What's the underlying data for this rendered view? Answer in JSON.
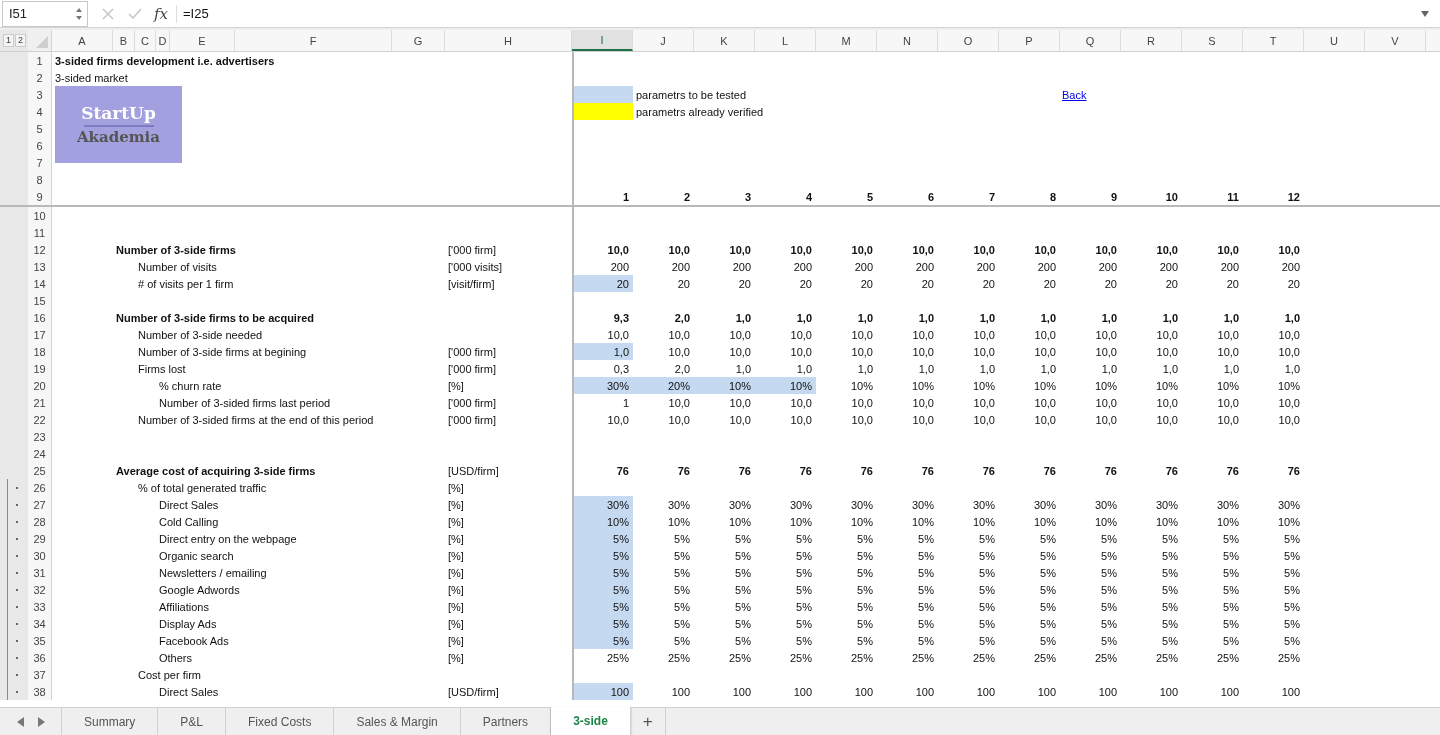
{
  "formula_bar": {
    "name_box": "I51",
    "function_label": "fx",
    "formula": "=I25"
  },
  "outline_levels": [
    "1",
    "2"
  ],
  "columns": [
    {
      "label": "A",
      "selected": false
    },
    {
      "label": "B",
      "selected": false
    },
    {
      "label": "C",
      "selected": false
    },
    {
      "label": "D",
      "selected": false
    },
    {
      "label": "E",
      "selected": false
    },
    {
      "label": "F",
      "selected": false
    },
    {
      "label": "G",
      "selected": false
    },
    {
      "label": "H",
      "selected": false
    },
    {
      "label": "I",
      "selected": true
    },
    {
      "label": "J",
      "selected": false
    },
    {
      "label": "K",
      "selected": false
    },
    {
      "label": "L",
      "selected": false
    },
    {
      "label": "M",
      "selected": false
    },
    {
      "label": "N",
      "selected": false
    },
    {
      "label": "O",
      "selected": false
    },
    {
      "label": "P",
      "selected": false
    },
    {
      "label": "Q",
      "selected": false
    },
    {
      "label": "R",
      "selected": false
    },
    {
      "label": "S",
      "selected": false
    },
    {
      "label": "T",
      "selected": false
    },
    {
      "label": "U",
      "selected": false
    },
    {
      "label": "V",
      "selected": false
    }
  ],
  "logo": {
    "title": "StartUp",
    "subtitle": "Akademia"
  },
  "frozen_rows": [
    {
      "n": "1",
      "kind": "title",
      "label": "3-sided firms development i.e. advertisers"
    },
    {
      "n": "2",
      "kind": "note",
      "label": "3-sided market"
    },
    {
      "n": "3",
      "kind": "legend",
      "legend": {
        "color": "#c5d9f1",
        "label": "parametrs to be tested"
      },
      "link": "Back"
    },
    {
      "n": "4",
      "kind": "legend",
      "legend": {
        "color": "#ffff00",
        "label": "parametrs already verified"
      }
    },
    {
      "n": "5",
      "kind": "blank"
    },
    {
      "n": "6",
      "kind": "blank"
    },
    {
      "n": "7",
      "kind": "blank"
    },
    {
      "n": "8",
      "kind": "blank"
    },
    {
      "n": "9",
      "kind": "index",
      "values": [
        "1",
        "2",
        "3",
        "4",
        "5",
        "6",
        "7",
        "8",
        "9",
        "10",
        "11",
        "12"
      ],
      "highlighted": [
        false,
        false,
        false,
        false,
        false,
        false,
        false,
        false,
        false,
        false,
        false,
        false
      ]
    }
  ],
  "rows": [
    {
      "n": "10",
      "kind": "blank",
      "grouped": false
    },
    {
      "n": "11",
      "kind": "blank",
      "grouped": false
    },
    {
      "n": "12",
      "kind": "heading",
      "grouped": false,
      "label": "Number of 3-side firms",
      "unit": "['000 firm]",
      "values": [
        "10,0",
        "10,0",
        "10,0",
        "10,0",
        "10,0",
        "10,0",
        "10,0",
        "10,0",
        "10,0",
        "10,0",
        "10,0",
        "10,0"
      ],
      "highlighted": [
        false,
        false,
        false,
        false,
        false,
        false,
        false,
        false,
        false,
        false,
        false,
        false
      ]
    },
    {
      "n": "13",
      "kind": "item",
      "grouped": false,
      "label": "Number of visits",
      "unit": "['000 visits]",
      "values": [
        "200",
        "200",
        "200",
        "200",
        "200",
        "200",
        "200",
        "200",
        "200",
        "200",
        "200",
        "200"
      ],
      "highlighted": [
        false,
        false,
        false,
        false,
        false,
        false,
        false,
        false,
        false,
        false,
        false,
        false
      ]
    },
    {
      "n": "14",
      "kind": "item",
      "grouped": false,
      "label": "# of visits per 1 firm",
      "unit": "[visit/firm]",
      "values": [
        "20",
        "20",
        "20",
        "20",
        "20",
        "20",
        "20",
        "20",
        "20",
        "20",
        "20",
        "20"
      ],
      "highlighted": [
        true,
        false,
        false,
        false,
        false,
        false,
        false,
        false,
        false,
        false,
        false,
        false
      ]
    },
    {
      "n": "15",
      "kind": "blank",
      "grouped": false
    },
    {
      "n": "16",
      "kind": "heading",
      "grouped": false,
      "label": "Number of 3-side firms to be acquired",
      "values": [
        "9,3",
        "2,0",
        "1,0",
        "1,0",
        "1,0",
        "1,0",
        "1,0",
        "1,0",
        "1,0",
        "1,0",
        "1,0",
        "1,0"
      ],
      "highlighted": [
        false,
        false,
        false,
        false,
        false,
        false,
        false,
        false,
        false,
        false,
        false,
        false
      ]
    },
    {
      "n": "17",
      "kind": "item",
      "grouped": false,
      "label": "Number of 3-side needed",
      "values": [
        "10,0",
        "10,0",
        "10,0",
        "10,0",
        "10,0",
        "10,0",
        "10,0",
        "10,0",
        "10,0",
        "10,0",
        "10,0",
        "10,0"
      ],
      "highlighted": [
        false,
        false,
        false,
        false,
        false,
        false,
        false,
        false,
        false,
        false,
        false,
        false
      ]
    },
    {
      "n": "18",
      "kind": "item",
      "grouped": false,
      "label": "Number of 3-side firms at begining",
      "unit": "['000 firm]",
      "values": [
        "1,0",
        "10,0",
        "10,0",
        "10,0",
        "10,0",
        "10,0",
        "10,0",
        "10,0",
        "10,0",
        "10,0",
        "10,0",
        "10,0"
      ],
      "highlighted": [
        true,
        false,
        false,
        false,
        false,
        false,
        false,
        false,
        false,
        false,
        false,
        false
      ]
    },
    {
      "n": "19",
      "kind": "item",
      "grouped": false,
      "label": "Firms lost",
      "unit": "['000 firm]",
      "values": [
        "0,3",
        "2,0",
        "1,0",
        "1,0",
        "1,0",
        "1,0",
        "1,0",
        "1,0",
        "1,0",
        "1,0",
        "1,0",
        "1,0"
      ],
      "highlighted": [
        false,
        false,
        false,
        false,
        false,
        false,
        false,
        false,
        false,
        false,
        false,
        false
      ]
    },
    {
      "n": "20",
      "kind": "subitem",
      "grouped": false,
      "label": "% churn rate",
      "unit": "[%]",
      "values": [
        "30%",
        "20%",
        "10%",
        "10%",
        "10%",
        "10%",
        "10%",
        "10%",
        "10%",
        "10%",
        "10%",
        "10%"
      ],
      "highlighted": [
        true,
        true,
        true,
        true,
        false,
        false,
        false,
        false,
        false,
        false,
        false,
        false
      ]
    },
    {
      "n": "21",
      "kind": "subitem",
      "grouped": false,
      "label": "Number of 3-sided firms last period",
      "unit": "['000 firm]",
      "values": [
        "1",
        "10,0",
        "10,0",
        "10,0",
        "10,0",
        "10,0",
        "10,0",
        "10,0",
        "10,0",
        "10,0",
        "10,0",
        "10,0"
      ],
      "highlighted": [
        false,
        false,
        false,
        false,
        false,
        false,
        false,
        false,
        false,
        false,
        false,
        false
      ]
    },
    {
      "n": "22",
      "kind": "item",
      "grouped": false,
      "label": "Number of 3-sided firms at the end of this period",
      "unit": "['000 firm]",
      "values": [
        "10,0",
        "10,0",
        "10,0",
        "10,0",
        "10,0",
        "10,0",
        "10,0",
        "10,0",
        "10,0",
        "10,0",
        "10,0",
        "10,0"
      ],
      "highlighted": [
        false,
        false,
        false,
        false,
        false,
        false,
        false,
        false,
        false,
        false,
        false,
        false
      ]
    },
    {
      "n": "23",
      "kind": "blank",
      "grouped": false
    },
    {
      "n": "24",
      "kind": "blank",
      "grouped": false
    },
    {
      "n": "25",
      "kind": "heading",
      "grouped": false,
      "label": "Average cost of acquiring 3-side firms",
      "unit": "[USD/firm]",
      "values": [
        "76",
        "76",
        "76",
        "76",
        "76",
        "76",
        "76",
        "76",
        "76",
        "76",
        "76",
        "76"
      ],
      "highlighted": [
        false,
        false,
        false,
        false,
        false,
        false,
        false,
        false,
        false,
        false,
        false,
        false
      ]
    },
    {
      "n": "26",
      "kind": "item",
      "grouped": true,
      "label": "% of total generated traffic",
      "unit": "[%]"
    },
    {
      "n": "27",
      "kind": "subitem",
      "grouped": true,
      "label": "Direct Sales",
      "unit": "[%]",
      "values": [
        "30%",
        "30%",
        "30%",
        "30%",
        "30%",
        "30%",
        "30%",
        "30%",
        "30%",
        "30%",
        "30%",
        "30%"
      ],
      "highlighted": [
        true,
        false,
        false,
        false,
        false,
        false,
        false,
        false,
        false,
        false,
        false,
        false
      ]
    },
    {
      "n": "28",
      "kind": "subitem",
      "grouped": true,
      "label": "Cold Calling",
      "unit": "[%]",
      "values": [
        "10%",
        "10%",
        "10%",
        "10%",
        "10%",
        "10%",
        "10%",
        "10%",
        "10%",
        "10%",
        "10%",
        "10%"
      ],
      "highlighted": [
        true,
        false,
        false,
        false,
        false,
        false,
        false,
        false,
        false,
        false,
        false,
        false
      ]
    },
    {
      "n": "29",
      "kind": "subitem",
      "grouped": true,
      "label": "Direct entry on the webpage",
      "unit": "[%]",
      "values": [
        "5%",
        "5%",
        "5%",
        "5%",
        "5%",
        "5%",
        "5%",
        "5%",
        "5%",
        "5%",
        "5%",
        "5%"
      ],
      "highlighted": [
        true,
        false,
        false,
        false,
        false,
        false,
        false,
        false,
        false,
        false,
        false,
        false
      ]
    },
    {
      "n": "30",
      "kind": "subitem",
      "grouped": true,
      "label": "Organic search",
      "unit": "[%]",
      "values": [
        "5%",
        "5%",
        "5%",
        "5%",
        "5%",
        "5%",
        "5%",
        "5%",
        "5%",
        "5%",
        "5%",
        "5%"
      ],
      "highlighted": [
        true,
        false,
        false,
        false,
        false,
        false,
        false,
        false,
        false,
        false,
        false,
        false
      ]
    },
    {
      "n": "31",
      "kind": "subitem",
      "grouped": true,
      "label": "Newsletters / emailing",
      "unit": "[%]",
      "values": [
        "5%",
        "5%",
        "5%",
        "5%",
        "5%",
        "5%",
        "5%",
        "5%",
        "5%",
        "5%",
        "5%",
        "5%"
      ],
      "highlighted": [
        true,
        false,
        false,
        false,
        false,
        false,
        false,
        false,
        false,
        false,
        false,
        false
      ]
    },
    {
      "n": "32",
      "kind": "subitem",
      "grouped": true,
      "label": "Google Adwords",
      "unit": "[%]",
      "values": [
        "5%",
        "5%",
        "5%",
        "5%",
        "5%",
        "5%",
        "5%",
        "5%",
        "5%",
        "5%",
        "5%",
        "5%"
      ],
      "highlighted": [
        true,
        false,
        false,
        false,
        false,
        false,
        false,
        false,
        false,
        false,
        false,
        false
      ]
    },
    {
      "n": "33",
      "kind": "subitem",
      "grouped": true,
      "label": "Affiliations",
      "unit": "[%]",
      "values": [
        "5%",
        "5%",
        "5%",
        "5%",
        "5%",
        "5%",
        "5%",
        "5%",
        "5%",
        "5%",
        "5%",
        "5%"
      ],
      "highlighted": [
        true,
        false,
        false,
        false,
        false,
        false,
        false,
        false,
        false,
        false,
        false,
        false
      ]
    },
    {
      "n": "34",
      "kind": "subitem",
      "grouped": true,
      "label": "Display Ads",
      "unit": "[%]",
      "values": [
        "5%",
        "5%",
        "5%",
        "5%",
        "5%",
        "5%",
        "5%",
        "5%",
        "5%",
        "5%",
        "5%",
        "5%"
      ],
      "highlighted": [
        true,
        false,
        false,
        false,
        false,
        false,
        false,
        false,
        false,
        false,
        false,
        false
      ]
    },
    {
      "n": "35",
      "kind": "subitem",
      "grouped": true,
      "label": "Facebook Ads",
      "unit": "[%]",
      "values": [
        "5%",
        "5%",
        "5%",
        "5%",
        "5%",
        "5%",
        "5%",
        "5%",
        "5%",
        "5%",
        "5%",
        "5%"
      ],
      "highlighted": [
        true,
        false,
        false,
        false,
        false,
        false,
        false,
        false,
        false,
        false,
        false,
        false
      ]
    },
    {
      "n": "36",
      "kind": "subitem",
      "grouped": true,
      "label": "Others",
      "unit": "[%]",
      "values": [
        "25%",
        "25%",
        "25%",
        "25%",
        "25%",
        "25%",
        "25%",
        "25%",
        "25%",
        "25%",
        "25%",
        "25%"
      ],
      "highlighted": [
        false,
        false,
        false,
        false,
        false,
        false,
        false,
        false,
        false,
        false,
        false,
        false
      ]
    },
    {
      "n": "37",
      "kind": "item",
      "grouped": true,
      "label": "Cost per firm"
    },
    {
      "n": "38",
      "kind": "subitem",
      "grouped": true,
      "label": "Direct Sales",
      "unit": "[USD/firm]",
      "values": [
        "100",
        "100",
        "100",
        "100",
        "100",
        "100",
        "100",
        "100",
        "100",
        "100",
        "100",
        "100"
      ],
      "highlighted": [
        true,
        false,
        false,
        false,
        false,
        false,
        false,
        false,
        false,
        false,
        false,
        false
      ]
    }
  ],
  "sheet_tabs": [
    {
      "label": "Summary",
      "selected": false
    },
    {
      "label": "P&L",
      "selected": false
    },
    {
      "label": "Fixed Costs",
      "selected": false
    },
    {
      "label": "Sales & Margin",
      "selected": false
    },
    {
      "label": "Partners",
      "selected": false
    },
    {
      "label": "3-side",
      "selected": true
    }
  ],
  "add_sheet": "+"
}
